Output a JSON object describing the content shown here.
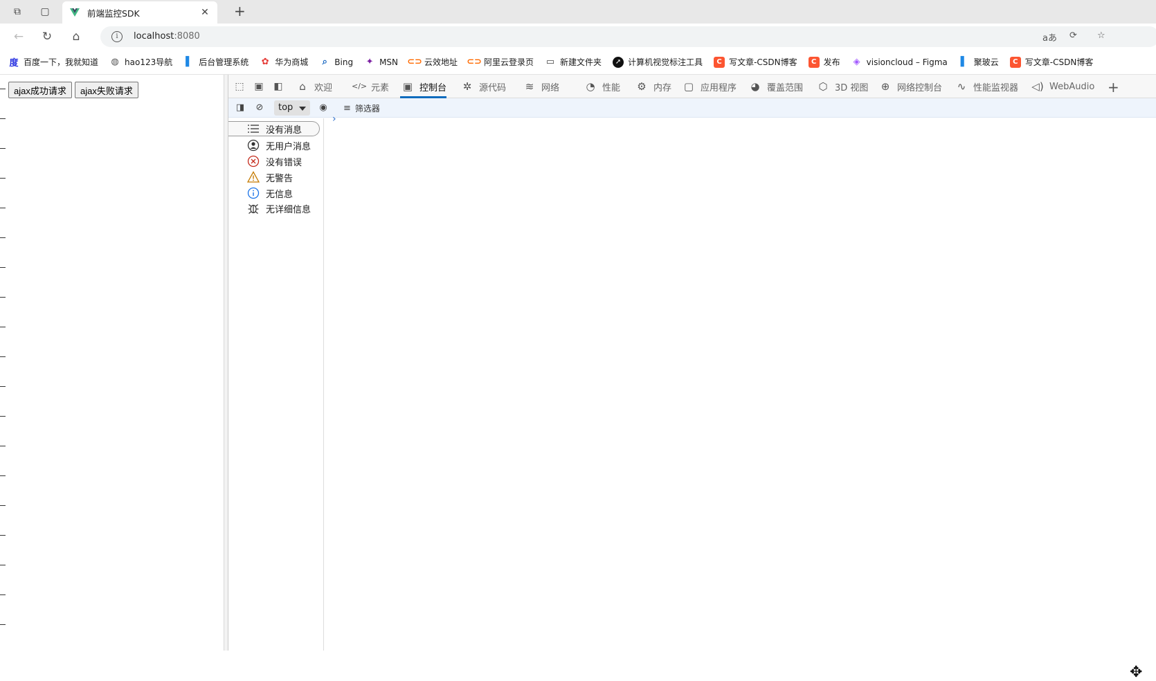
{
  "browser": {
    "tab": {
      "title": "前端监控SDK"
    },
    "address": {
      "host": "localhost",
      "port": ":8080"
    },
    "bookmarks": [
      {
        "label": "百度一下，我就知道",
        "icon": "baidu-icon",
        "color": "#2932e1"
      },
      {
        "label": "hao123导航",
        "icon": "globe-icon",
        "color": "#555555"
      },
      {
        "label": "后台管理系统",
        "icon": "app-icon",
        "color": "#1e88e5"
      },
      {
        "label": "华为商城",
        "icon": "huawei-icon",
        "color": "#e53935"
      },
      {
        "label": "Bing",
        "icon": "search-icon",
        "color": "#1565c0"
      },
      {
        "label": "MSN",
        "icon": "msn-icon",
        "color": "#7b1fa2"
      },
      {
        "label": "云效地址",
        "icon": "aliyun-icon",
        "color": "#ff6a00"
      },
      {
        "label": "阿里云登录页",
        "icon": "aliyun-icon",
        "color": "#ff6a00"
      },
      {
        "label": "新建文件夹",
        "icon": "folder-icon",
        "color": "#444444"
      },
      {
        "label": "计算机视觉标注工具",
        "icon": "tool-icon",
        "color": "#111111"
      },
      {
        "label": "写文章-CSDN博客",
        "icon": "csdn-icon",
        "color": "#fc5531"
      },
      {
        "label": "发布",
        "icon": "csdn-icon",
        "color": "#fc5531"
      },
      {
        "label": "visioncloud – Figma",
        "icon": "figma-icon",
        "color": "#a259ff"
      },
      {
        "label": "聚玻云",
        "icon": "app-icon",
        "color": "#1e88e5"
      },
      {
        "label": "写文章-CSDN博客",
        "icon": "csdn-icon",
        "color": "#fc5531"
      }
    ]
  },
  "page": {
    "buttons": {
      "success": "ajax成功请求",
      "fail": "ajax失败请求"
    }
  },
  "devtools": {
    "tabs": [
      {
        "label": "欢迎",
        "icon": "home-icon",
        "active": false
      },
      {
        "label": "元素",
        "icon": "code-icon",
        "active": false
      },
      {
        "label": "控制台",
        "icon": "console-icon",
        "active": true
      },
      {
        "label": "源代码",
        "icon": "bug-icon",
        "active": false
      },
      {
        "label": "网络",
        "icon": "wifi-icon",
        "active": false
      },
      {
        "label": "性能",
        "icon": "gauge-icon",
        "active": false
      },
      {
        "label": "内存",
        "icon": "chip-icon",
        "active": false
      },
      {
        "label": "应用程序",
        "icon": "app-window-icon",
        "active": false
      },
      {
        "label": "覆盖范围",
        "icon": "coverage-icon",
        "active": false
      },
      {
        "label": "3D 视图",
        "icon": "cube-icon",
        "active": false
      },
      {
        "label": "网络控制台",
        "icon": "network-console-icon",
        "active": false
      },
      {
        "label": "性能监视器",
        "icon": "pulse-icon",
        "active": false
      },
      {
        "label": "WebAudio",
        "icon": "speaker-icon",
        "active": false
      }
    ],
    "console": {
      "context": "top",
      "filter_label": "筛选器",
      "sidebar": [
        {
          "label": "没有消息",
          "icon": "list-icon"
        },
        {
          "label": "无用户消息",
          "icon": "user-icon"
        },
        {
          "label": "没有错误",
          "icon": "error-icon"
        },
        {
          "label": "无警告",
          "icon": "warning-icon"
        },
        {
          "label": "无信息",
          "icon": "info-icon"
        },
        {
          "label": "无详细信息",
          "icon": "bug-icon"
        }
      ],
      "prompt": "›"
    },
    "accent": "#0f6cbd"
  }
}
